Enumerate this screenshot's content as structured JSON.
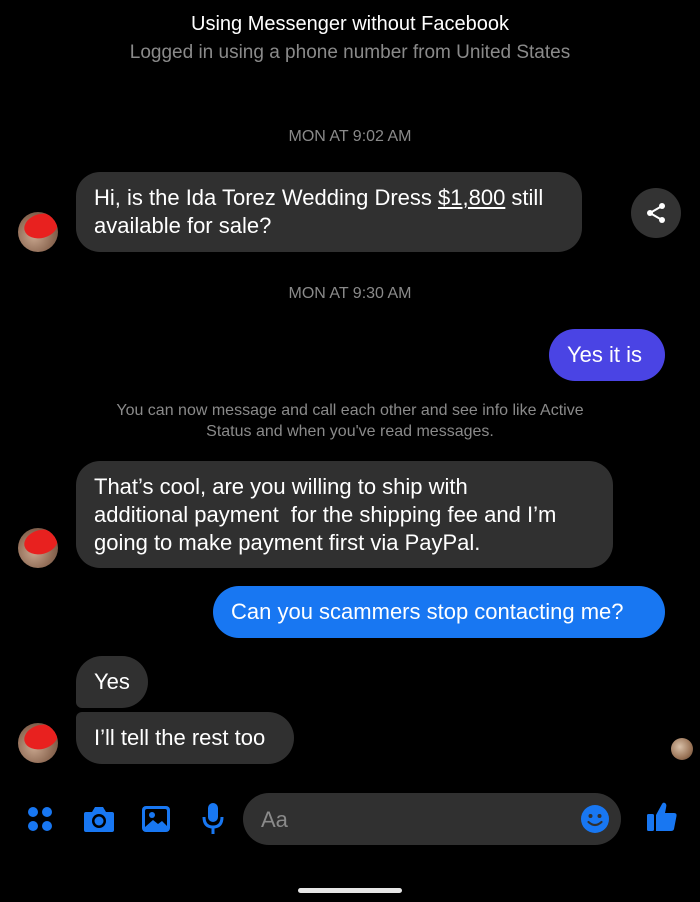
{
  "header": {
    "title": "Using Messenger without Facebook",
    "subtitle": "Logged in using a phone number from United States"
  },
  "timestamps": [
    "MON AT 9:02 AM",
    "MON AT 9:30 AM"
  ],
  "messages": [
    {
      "text_before": "Hi, is the Ida Torez Wedding Dress ",
      "link": "$1,800",
      "text_after": " still",
      "line2": "available for sale?"
    },
    {
      "text": "Yes it is"
    },
    {
      "lines": [
        "That’s cool, are you willing to ship with",
        "additional payment  for the shipping fee and I’m",
        "going to make payment first via PayPal."
      ]
    },
    {
      "text": "Can you scammers stop contacting me?"
    },
    {
      "text": "Yes"
    },
    {
      "text": "I’ll tell the rest too"
    }
  ],
  "notice": {
    "line1": "You can now message and call each other and see info like Active",
    "line2": "Status and when you've read messages."
  },
  "composer": {
    "placeholder": "Aa"
  },
  "colors": {
    "background": "#000000",
    "incoming_bubble": "#303030",
    "outgoing_purple": "#4a44e4",
    "outgoing_blue": "#1877f2",
    "accent_icons": "#1877f2",
    "muted_text": "#8a8a8a"
  },
  "icons": [
    "share-icon",
    "apps-icon",
    "camera-icon",
    "gallery-icon",
    "microphone-icon",
    "emoji-icon",
    "thumbs-up-icon"
  ]
}
